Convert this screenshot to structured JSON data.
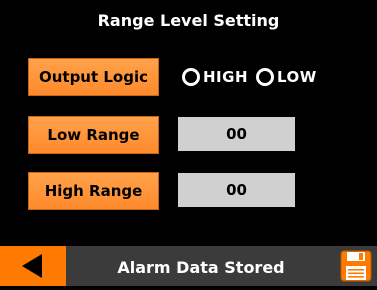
{
  "screen": {
    "title": "Range Level Setting"
  },
  "output_logic": {
    "button_label": "Output Logic",
    "options": [
      "HIGH",
      "LOW"
    ],
    "selected": null
  },
  "low_range": {
    "button_label": "Low Range",
    "value": "00"
  },
  "high_range": {
    "button_label": "High Range",
    "value": "00"
  },
  "footer": {
    "status": "Alarm Data Stored",
    "back_icon": "back-arrow-icon",
    "save_icon": "floppy-disk-icon"
  },
  "colors": {
    "accent": "#ff8a2c",
    "footer_bg": "#3b3b3b",
    "value_bg": "#d0d0d0",
    "background": "#000000"
  }
}
